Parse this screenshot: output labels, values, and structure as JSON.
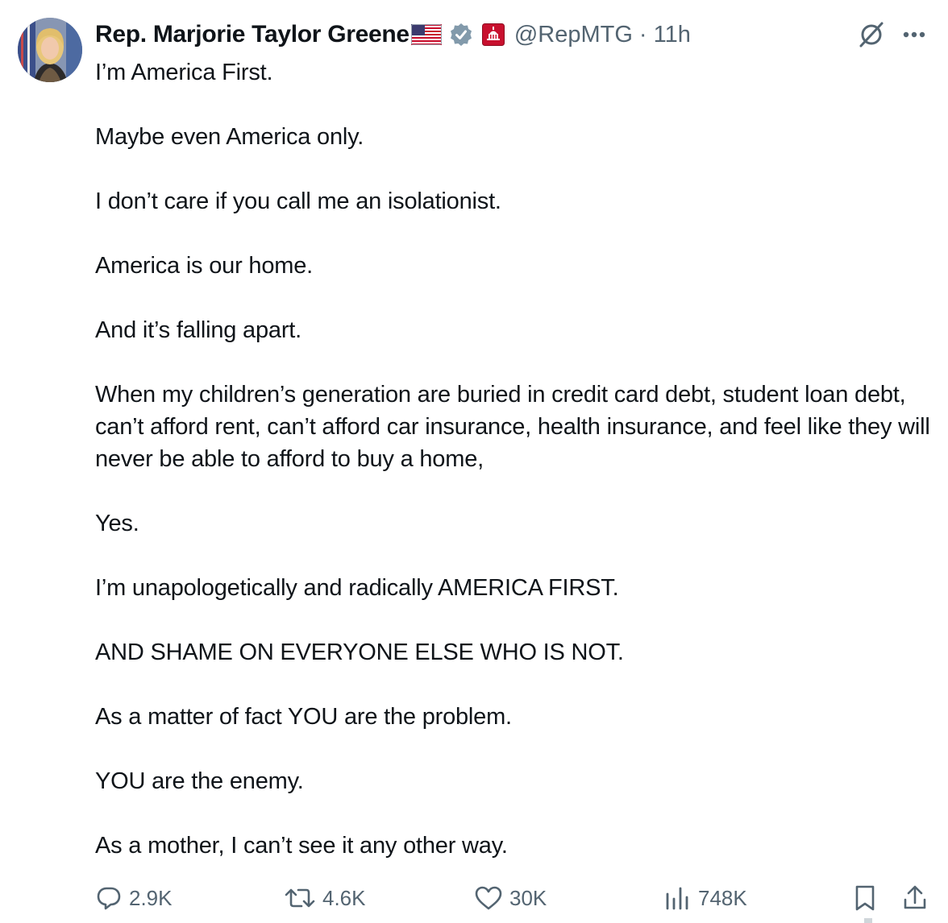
{
  "tweet": {
    "display_name": "Rep. Marjorie Taylor Greene",
    "handle_time": "@RepMTG · 11h",
    "flag_icon": "us-flag-emoji",
    "verified_icon": "verified-badge-icon",
    "affiliation_icon": "us-capitol-badge-icon",
    "paragraphs": [
      "I’m America First.",
      "Maybe even America only.",
      "I don’t care if you call me an isolationist.",
      "America is our home.",
      "And it’s falling apart.",
      "When my children’s generation are buried in credit card debt, student loan debt, can’t afford rent, can’t afford car insurance, health insurance, and feel like they will never be able to afford to buy a home,",
      "Yes.",
      "I’m unapologetically and radically AMERICA FIRST.",
      "AND SHAME ON EVERYONE ELSE WHO IS NOT.",
      "As a matter of fact YOU are the problem.",
      "YOU are the enemy.",
      "As a mother, I can’t see it any other way."
    ]
  },
  "actions": {
    "replies": "2.9K",
    "reposts": "4.6K",
    "likes": "30K",
    "views": "748K"
  },
  "colors": {
    "text": "#0f1419",
    "secondary": "#536471",
    "verified_gray": "#829aab",
    "badge_red": "#c8102e"
  }
}
